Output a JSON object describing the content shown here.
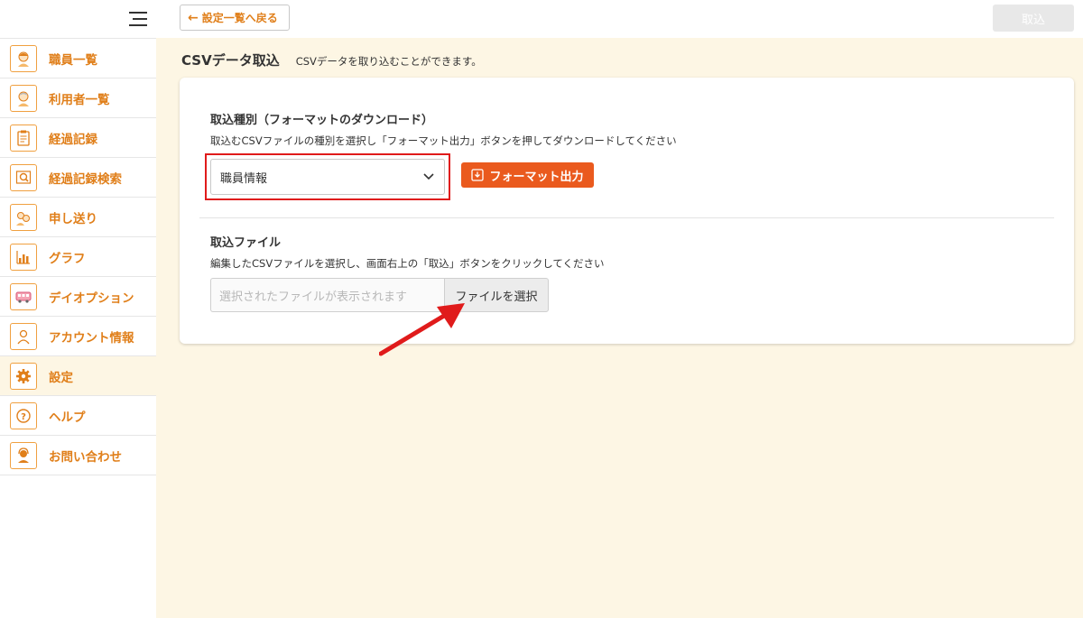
{
  "sidebar": {
    "items": [
      {
        "label": "職員一覧",
        "icon": "staff-face-icon"
      },
      {
        "label": "利用者一覧",
        "icon": "elder-face-icon"
      },
      {
        "label": "経過記録",
        "icon": "clipboard-icon"
      },
      {
        "label": "経過記録検索",
        "icon": "search-record-icon"
      },
      {
        "label": "申し送り",
        "icon": "handover-icon"
      },
      {
        "label": "グラフ",
        "icon": "bar-chart-icon"
      },
      {
        "label": "デイオプション",
        "icon": "bus-icon"
      },
      {
        "label": "アカウント情報",
        "icon": "person-icon"
      },
      {
        "label": "設定",
        "icon": "gear-icon"
      },
      {
        "label": "ヘルプ",
        "icon": "help-icon"
      },
      {
        "label": "お問い合わせ",
        "icon": "support-icon"
      }
    ]
  },
  "header": {
    "back_label": "設定一覧へ戻る",
    "import_label": "取込"
  },
  "page": {
    "title": "CSVデータ取込",
    "description": "CSVデータを取り込むことができます。"
  },
  "format_section": {
    "title": "取込種別（フォーマットのダウンロード）",
    "description": "取込むCSVファイルの種別を選択し「フォーマット出力」ボタンを押してダウンロードしてください",
    "selected_value": "職員情報",
    "button_label": "フォーマット出力"
  },
  "file_section": {
    "title": "取込ファイル",
    "description": "編集したCSVファイルを選択し、画面右上の「取込」ボタンをクリックしてください",
    "placeholder": "選択されたファイルが表示されます",
    "button_label": "ファイルを選択"
  },
  "colors": {
    "accent": "#e07f1a",
    "primary_button": "#ea5a1e",
    "highlight_box": "#e01b1b",
    "main_background": "#fdf6e4"
  }
}
